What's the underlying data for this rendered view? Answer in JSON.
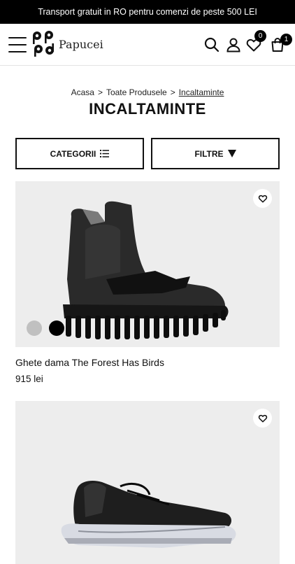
{
  "promo": {
    "text": "Transport gratuit in RO pentru comenzi de peste 500 LEI"
  },
  "header": {
    "logo_text": "Papucei",
    "wishlist_count": "0",
    "cart_count": "1",
    "icons": [
      "menu-icon",
      "search-icon",
      "user-icon",
      "heart-icon",
      "bag-icon"
    ]
  },
  "breadcrumb": {
    "items": [
      "Acasa",
      "Toate Produsele",
      "Incaltaminte"
    ],
    "separator": ">"
  },
  "page_title": "INCALTAMINTE",
  "filters": {
    "categories_label": "CATEGORII",
    "filters_label": "FILTRE"
  },
  "products": [
    {
      "name": "Ghete dama The Forest Has Birds",
      "price": "915 lei",
      "swatches": [
        "#c0c0c0",
        "#000000"
      ]
    },
    {
      "name": "",
      "price": "",
      "swatches": []
    }
  ]
}
